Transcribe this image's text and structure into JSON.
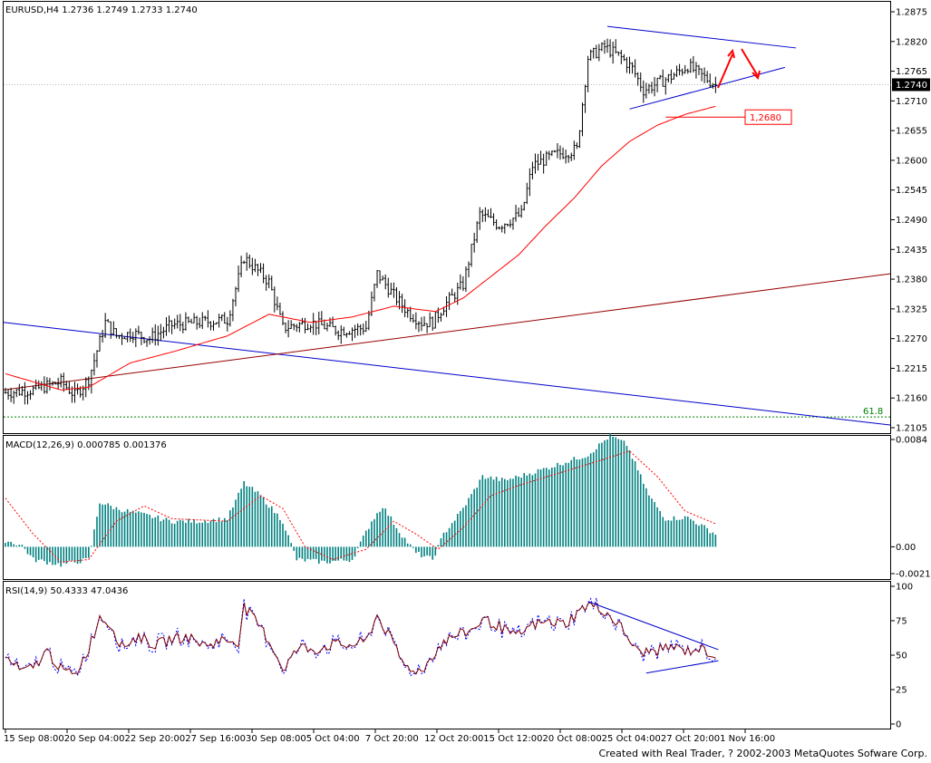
{
  "footer_text": "Created with Real Trader, ? 2002-2003 MetaQuotes Sofware Corp.",
  "colors": {
    "price_bars": "#000000",
    "ma": "#ff0000",
    "trend_blue": "#0000cc",
    "trend_red": "#990000",
    "macd_hist": "#008080",
    "macd_signal": "#ff0000",
    "rsi_main": "#800000",
    "rsi_signal": "#0000ff",
    "fib": "#008000",
    "annotation": "#ff0000"
  },
  "chart_data": [
    {
      "type": "candlestick",
      "title": "EURUSD,H4",
      "ohlc_label": "1.2736 1.2749 1.2733 1.2740",
      "current_price": "1.2740",
      "ylim": [
        1.2105,
        1.2875
      ],
      "y_ticks": [
        "1.2875",
        "1.2820",
        "1.2765",
        "1.2710",
        "1.2655",
        "1.2600",
        "1.2545",
        "1.2490",
        "1.2435",
        "1.2380",
        "1.2325",
        "1.2270",
        "1.2215",
        "1.2160",
        "1.2105"
      ],
      "x_ticks": [
        "15 Sep 08:00",
        "20 Sep 04:00",
        "22 Sep 20:00",
        "27 Sep 16:00",
        "30 Sep 08:00",
        "5 Oct 04:00",
        "7 Oct 20:00",
        "12 Oct 20:00",
        "15 Oct 12:00",
        "20 Oct 08:00",
        "25 Oct 04:00",
        "27 Oct 20:00",
        "1 Nov 16:00"
      ],
      "x_tick_labels_printed": "15 Sep 08:0020 Sep 04:0022 Sep 20:0027 Sep 16:0030 Sep 08:005 Oct 04:00  7 Oct 20:00  12 Oct 20:0015 Oct 12:0020 Oct 08:0025 Oct 04:0027 Oct 20:001 Nov 16:00",
      "close_anchors": [
        [
          0,
          1.217
        ],
        [
          10,
          1.2175
        ],
        [
          20,
          1.219
        ],
        [
          25,
          1.2165
        ],
        [
          30,
          1.2195
        ],
        [
          36,
          1.23
        ],
        [
          40,
          1.2275
        ],
        [
          46,
          1.228
        ],
        [
          52,
          1.227
        ],
        [
          60,
          1.2295
        ],
        [
          70,
          1.23
        ],
        [
          80,
          1.2305
        ],
        [
          86,
          1.242
        ],
        [
          95,
          1.2375
        ],
        [
          100,
          1.229
        ],
        [
          110,
          1.23
        ],
        [
          120,
          1.2285
        ],
        [
          130,
          1.229
        ],
        [
          134,
          1.239
        ],
        [
          140,
          1.235
        ],
        [
          145,
          1.232
        ],
        [
          150,
          1.23
        ],
        [
          154,
          1.23
        ],
        [
          158,
          1.233
        ],
        [
          165,
          1.237
        ],
        [
          171,
          1.25
        ],
        [
          178,
          1.248
        ],
        [
          186,
          1.25
        ],
        [
          190,
          1.259
        ],
        [
          198,
          1.261
        ],
        [
          206,
          1.262
        ],
        [
          210,
          1.279
        ],
        [
          216,
          1.281
        ],
        [
          222,
          1.279
        ],
        [
          226,
          1.277
        ],
        [
          230,
          1.273
        ],
        [
          234,
          1.274
        ],
        [
          240,
          1.2755
        ],
        [
          246,
          1.2775
        ],
        [
          250,
          1.276
        ],
        [
          256,
          1.274
        ]
      ],
      "ma_anchors": [
        [
          0,
          1.2205
        ],
        [
          20,
          1.2175
        ],
        [
          30,
          1.218
        ],
        [
          45,
          1.2225
        ],
        [
          60,
          1.2245
        ],
        [
          80,
          1.2275
        ],
        [
          95,
          1.2315
        ],
        [
          110,
          1.23
        ],
        [
          125,
          1.231
        ],
        [
          140,
          1.233
        ],
        [
          155,
          1.232
        ],
        [
          165,
          1.2345
        ],
        [
          175,
          1.2385
        ],
        [
          185,
          1.2425
        ],
        [
          195,
          1.248
        ],
        [
          205,
          1.253
        ],
        [
          215,
          1.259
        ],
        [
          225,
          1.2635
        ],
        [
          235,
          1.2665
        ],
        [
          245,
          1.2685
        ],
        [
          256,
          1.27
        ]
      ],
      "annotations": {
        "label": "1,2680",
        "level": 1.268,
        "fib_label": "61.8",
        "fib_level": 1.2125
      }
    },
    {
      "type": "bar",
      "title": "MACD(12,26,9)",
      "values_label": "0.000785 0.001376",
      "ylim": [
        -0.0021,
        0.0084
      ],
      "y_ticks": [
        "0.0084",
        "0.00",
        "-0.0021"
      ],
      "hist_anchors": [
        [
          0,
          0.0005
        ],
        [
          6,
          0.0001
        ],
        [
          10,
          -0.001
        ],
        [
          20,
          -0.0014
        ],
        [
          30,
          -0.001
        ],
        [
          34,
          0.0035
        ],
        [
          40,
          0.003
        ],
        [
          50,
          0.0025
        ],
        [
          60,
          0.002
        ],
        [
          70,
          0.002
        ],
        [
          80,
          0.0022
        ],
        [
          86,
          0.005
        ],
        [
          92,
          0.004
        ],
        [
          100,
          0.002
        ],
        [
          105,
          -0.001
        ],
        [
          115,
          -0.0012
        ],
        [
          125,
          -0.001
        ],
        [
          132,
          0.002
        ],
        [
          136,
          0.0032
        ],
        [
          142,
          0.0012
        ],
        [
          148,
          -0.0005
        ],
        [
          154,
          -0.001
        ],
        [
          158,
          0.001
        ],
        [
          165,
          0.003
        ],
        [
          172,
          0.0055
        ],
        [
          180,
          0.0052
        ],
        [
          190,
          0.0058
        ],
        [
          200,
          0.0065
        ],
        [
          210,
          0.0072
        ],
        [
          218,
          0.0087
        ],
        [
          224,
          0.008
        ],
        [
          232,
          0.004
        ],
        [
          238,
          0.0022
        ],
        [
          246,
          0.0023
        ],
        [
          256,
          0.001
        ]
      ],
      "signal_anchors": [
        [
          0,
          0.0038
        ],
        [
          10,
          0.001
        ],
        [
          20,
          -0.0012
        ],
        [
          30,
          -0.001
        ],
        [
          40,
          0.002
        ],
        [
          50,
          0.0032
        ],
        [
          60,
          0.0022
        ],
        [
          80,
          0.002
        ],
        [
          92,
          0.004
        ],
        [
          100,
          0.003
        ],
        [
          108,
          0.0
        ],
        [
          118,
          -0.001
        ],
        [
          130,
          -0.0002
        ],
        [
          140,
          0.002
        ],
        [
          148,
          0.001
        ],
        [
          156,
          -0.0002
        ],
        [
          165,
          0.0015
        ],
        [
          175,
          0.004
        ],
        [
          185,
          0.0048
        ],
        [
          200,
          0.0058
        ],
        [
          215,
          0.0068
        ],
        [
          225,
          0.0075
        ],
        [
          235,
          0.0055
        ],
        [
          245,
          0.0028
        ],
        [
          256,
          0.0018
        ]
      ]
    },
    {
      "type": "line",
      "title": "RSI(14,9)",
      "values_label": "50.4333 47.0436",
      "ylim": [
        0,
        100
      ],
      "y_ticks": [
        "100",
        "75",
        "50",
        "25",
        "0"
      ],
      "rsi_anchors": [
        [
          0,
          48
        ],
        [
          6,
          38
        ],
        [
          10,
          41
        ],
        [
          15,
          53
        ],
        [
          20,
          40
        ],
        [
          25,
          35
        ],
        [
          30,
          55
        ],
        [
          34,
          78
        ],
        [
          38,
          72
        ],
        [
          42,
          56
        ],
        [
          48,
          64
        ],
        [
          54,
          57
        ],
        [
          60,
          62
        ],
        [
          66,
          63
        ],
        [
          72,
          57
        ],
        [
          78,
          61
        ],
        [
          84,
          60
        ],
        [
          86,
          85
        ],
        [
          92,
          70
        ],
        [
          96,
          57
        ],
        [
          100,
          40
        ],
        [
          106,
          56
        ],
        [
          112,
          54
        ],
        [
          118,
          58
        ],
        [
          124,
          57
        ],
        [
          130,
          60
        ],
        [
          134,
          79
        ],
        [
          138,
          65
        ],
        [
          144,
          42
        ],
        [
          150,
          38
        ],
        [
          154,
          50
        ],
        [
          158,
          60
        ],
        [
          162,
          64
        ],
        [
          168,
          68
        ],
        [
          172,
          76
        ],
        [
          178,
          71
        ],
        [
          184,
          63
        ],
        [
          190,
          72
        ],
        [
          196,
          74
        ],
        [
          202,
          73
        ],
        [
          206,
          80
        ],
        [
          210,
          87
        ],
        [
          216,
          82
        ],
        [
          222,
          70
        ],
        [
          228,
          52
        ],
        [
          234,
          53
        ],
        [
          240,
          56
        ],
        [
          246,
          53
        ],
        [
          250,
          55
        ],
        [
          256,
          50
        ]
      ]
    }
  ]
}
